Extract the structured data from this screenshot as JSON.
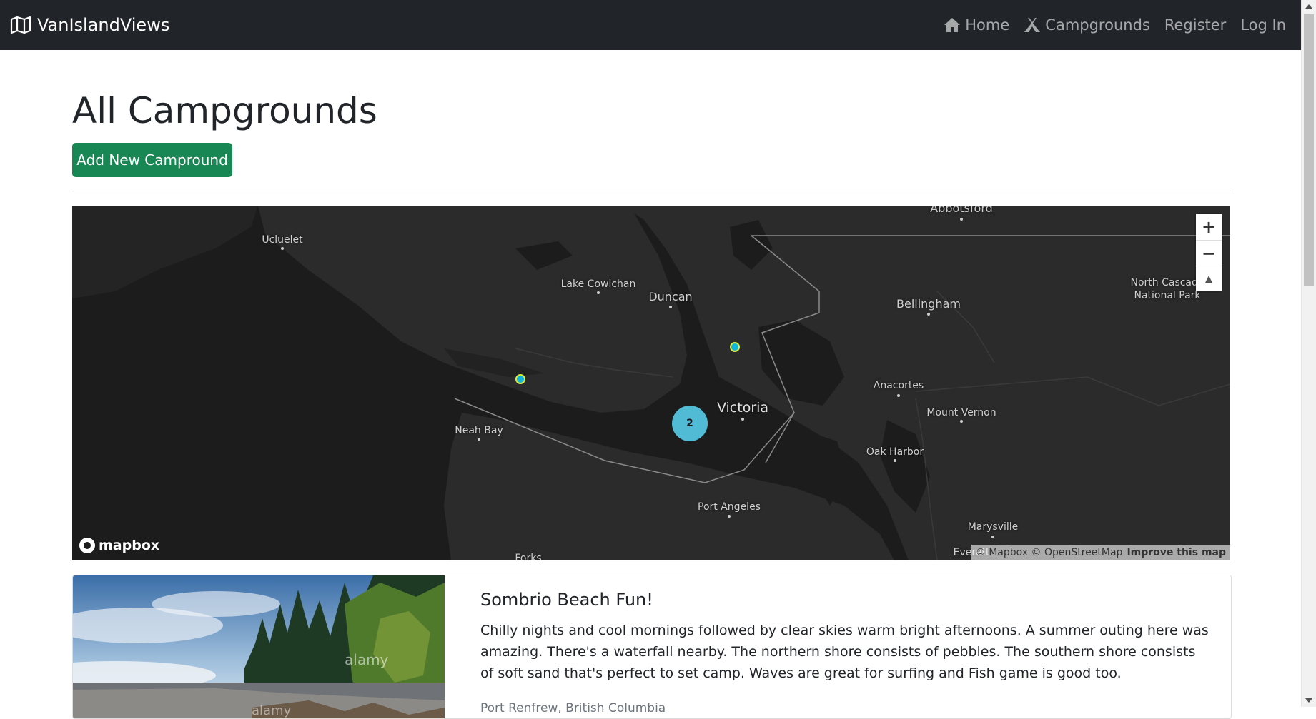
{
  "navbar": {
    "brand": "VanIslandViews",
    "brand_icon": "map-icon",
    "links": [
      {
        "label": "Home",
        "icon": "home-icon"
      },
      {
        "label": "Campgrounds",
        "icon": "campground-icon"
      },
      {
        "label": "Register"
      },
      {
        "label": "Log In"
      }
    ]
  },
  "main": {
    "title": "All Campgrounds",
    "add_button": "Add New Campround"
  },
  "map": {
    "labels": {
      "abbotsford": "Abbotsford",
      "ucluelet": "Ucluelet",
      "lake_cowichan": "Lake Cowichan",
      "duncan": "Duncan",
      "bellingham": "Bellingham",
      "north_cascades": "North Cascade",
      "national_park": "National Park",
      "anacortes": "Anacortes",
      "victoria": "Victoria",
      "mount_vernon": "Mount Vernon",
      "neah_bay": "Neah Bay",
      "oak_harbor": "Oak Harbor",
      "port_angeles": "Port Angeles",
      "marysville": "Marysville",
      "everett": "Everett",
      "forks": "Forks"
    },
    "cluster_count": "2",
    "zoom_in": "+",
    "zoom_out": "−",
    "compass": "▲",
    "logo_text": "mapbox",
    "attribution": "© Mapbox © OpenStreetMap",
    "improve": "Improve this map",
    "colors": {
      "marker": "#11b4da",
      "cluster": "#51bbd6",
      "water": "#1c1c1c",
      "land": "#2b2b2b"
    }
  },
  "campground": {
    "title": "Sombrio Beach Fun!",
    "description": "Chilly nights and cool mornings followed by clear skies warm bright afternoons. A summer outing here was amazing. There's a waterfall nearby. The northern shore consists of pebbles. The southern shore consists of soft sand that's perfect to set camp. Waves are great for surfing and Fish game is good too.",
    "location": "Port Renfrew, British Columbia",
    "watermark": "alamy"
  }
}
